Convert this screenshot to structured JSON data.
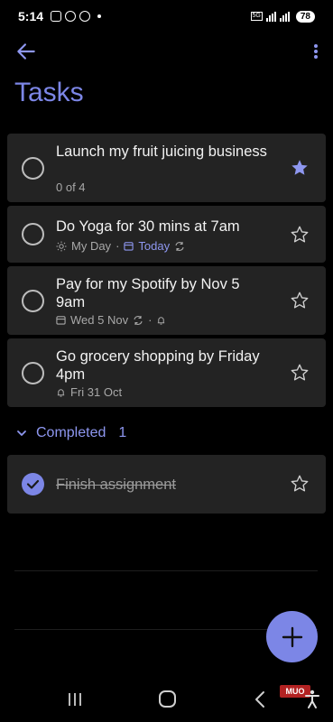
{
  "status_bar": {
    "time": "5:14",
    "network_tag": "5G",
    "battery": "78"
  },
  "header": {
    "title": "Tasks",
    "back_icon": "arrow-left-icon",
    "more_icon": "more-vertical-icon"
  },
  "tasks": [
    {
      "title": "Launch my fruit juicing business",
      "subtitle": "0 of 4",
      "starred": true
    },
    {
      "title": "Do Yoga for 30 mins at 7am",
      "my_day_label": "My Day",
      "due_label": "Today",
      "repeat": true,
      "starred": false
    },
    {
      "title": "Pay for my Spotify by Nov 5 9am",
      "due_label": "Wed 5 Nov",
      "repeat": true,
      "reminder": true,
      "starred": false
    },
    {
      "title": "Go grocery shopping by Friday 4pm",
      "reminder_label": "Fri 31 Oct",
      "starred": false
    }
  ],
  "completed": {
    "label": "Completed",
    "count": "1",
    "items": [
      {
        "title": "Finish assignment",
        "starred": false
      }
    ]
  },
  "watermark": "MUO",
  "colors": {
    "accent": "#7c86e6",
    "card": "#232323",
    "background": "#000000"
  }
}
